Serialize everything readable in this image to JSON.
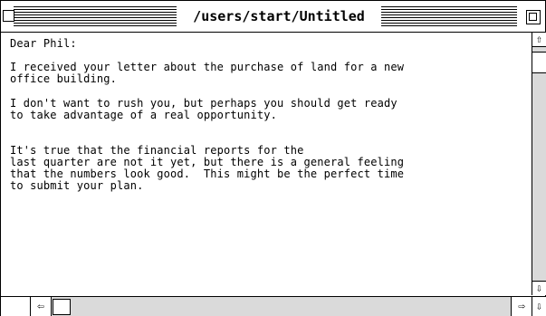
{
  "window": {
    "title": "/users/start/Untitled"
  },
  "document": {
    "paragraphs": [
      "Dear Phil:",
      "I received your letter about the purchase of land for a new\noffice building.",
      "I don't want to rush you, but perhaps you should get ready\nto take advantage of a real opportunity.",
      "It's true that the financial reports for the\nlast quarter are not it yet, but there is a general feeling\nthat the numbers look good.  This might be the perfect time\nto submit your plan."
    ]
  },
  "scrollbars": {
    "up_arrow": "⇧",
    "down_arrow": "⇩",
    "left_arrow": "⇦",
    "right_arrow": "⇨",
    "icons": {
      "up": "up-arrow-icon",
      "down": "down-arrow-icon",
      "left": "left-arrow-icon",
      "right": "right-arrow-icon"
    }
  }
}
